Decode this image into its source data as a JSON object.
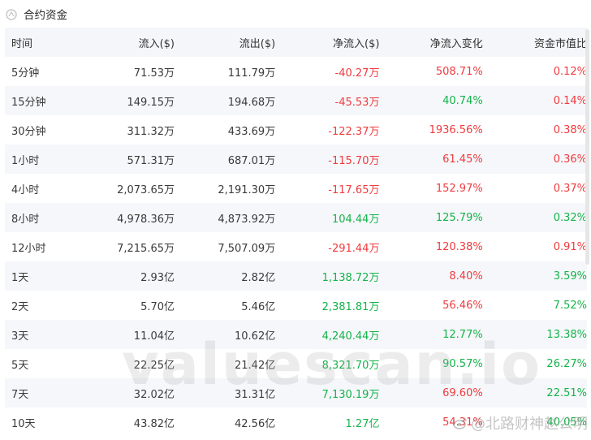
{
  "header": {
    "title": "合约资金"
  },
  "table": {
    "columns": [
      "时间",
      "流入($)",
      "流出($)",
      "净流入($)",
      "净流入变化",
      "资金市值比"
    ],
    "rows": [
      {
        "time": "5分钟",
        "inflow": "71.53万",
        "outflow": "111.79万",
        "net": "-40.27万",
        "net_dir": "neg",
        "change": "508.71%",
        "change_dir": "neg",
        "ratio": "0.12%",
        "ratio_dir": "neg"
      },
      {
        "time": "15分钟",
        "inflow": "149.15万",
        "outflow": "194.68万",
        "net": "-45.53万",
        "net_dir": "neg",
        "change": "40.74%",
        "change_dir": "pos",
        "ratio": "0.14%",
        "ratio_dir": "neg"
      },
      {
        "time": "30分钟",
        "inflow": "311.32万",
        "outflow": "433.69万",
        "net": "-122.37万",
        "net_dir": "neg",
        "change": "1936.56%",
        "change_dir": "neg",
        "ratio": "0.38%",
        "ratio_dir": "neg"
      },
      {
        "time": "1小时",
        "inflow": "571.31万",
        "outflow": "687.01万",
        "net": "-115.70万",
        "net_dir": "neg",
        "change": "61.45%",
        "change_dir": "neg",
        "ratio": "0.36%",
        "ratio_dir": "neg"
      },
      {
        "time": "4小时",
        "inflow": "2,073.65万",
        "outflow": "2,191.30万",
        "net": "-117.65万",
        "net_dir": "neg",
        "change": "152.97%",
        "change_dir": "neg",
        "ratio": "0.37%",
        "ratio_dir": "neg"
      },
      {
        "time": "8小时",
        "inflow": "4,978.36万",
        "outflow": "4,873.92万",
        "net": "104.44万",
        "net_dir": "pos",
        "change": "125.79%",
        "change_dir": "pos",
        "ratio": "0.32%",
        "ratio_dir": "pos"
      },
      {
        "time": "12小时",
        "inflow": "7,215.65万",
        "outflow": "7,507.09万",
        "net": "-291.44万",
        "net_dir": "neg",
        "change": "120.38%",
        "change_dir": "neg",
        "ratio": "0.91%",
        "ratio_dir": "neg"
      },
      {
        "time": "1天",
        "inflow": "2.93亿",
        "outflow": "2.82亿",
        "net": "1,138.72万",
        "net_dir": "pos",
        "change": "8.40%",
        "change_dir": "neg",
        "ratio": "3.59%",
        "ratio_dir": "pos"
      },
      {
        "time": "2天",
        "inflow": "5.70亿",
        "outflow": "5.46亿",
        "net": "2,381.81万",
        "net_dir": "pos",
        "change": "56.46%",
        "change_dir": "neg",
        "ratio": "7.52%",
        "ratio_dir": "pos"
      },
      {
        "time": "3天",
        "inflow": "11.04亿",
        "outflow": "10.62亿",
        "net": "4,240.44万",
        "net_dir": "pos",
        "change": "12.77%",
        "change_dir": "pos",
        "ratio": "13.38%",
        "ratio_dir": "pos"
      },
      {
        "time": "5天",
        "inflow": "22.25亿",
        "outflow": "21.42亿",
        "net": "8,321.70万",
        "net_dir": "pos",
        "change": "90.57%",
        "change_dir": "pos",
        "ratio": "26.27%",
        "ratio_dir": "pos"
      },
      {
        "time": "7天",
        "inflow": "32.02亿",
        "outflow": "31.31亿",
        "net": "7,130.19万",
        "net_dir": "pos",
        "change": "69.60%",
        "change_dir": "neg",
        "ratio": "22.51%",
        "ratio_dir": "pos"
      },
      {
        "time": "10天",
        "inflow": "43.82亿",
        "outflow": "42.56亿",
        "net": "1.27亿",
        "net_dir": "pos",
        "change": "54.31%",
        "change_dir": "neg",
        "ratio": "40.05%",
        "ratio_dir": "pos"
      }
    ]
  },
  "watermark": {
    "text": "valuescan.io"
  },
  "credit": {
    "text": "@北路财神赵公明",
    "icon": "weibo-icon"
  },
  "colors": {
    "negative": "#f03a3e",
    "positive": "#15b34a",
    "header_bg": "#f4f6f9",
    "stripe_bg": "#f5f7fa"
  }
}
